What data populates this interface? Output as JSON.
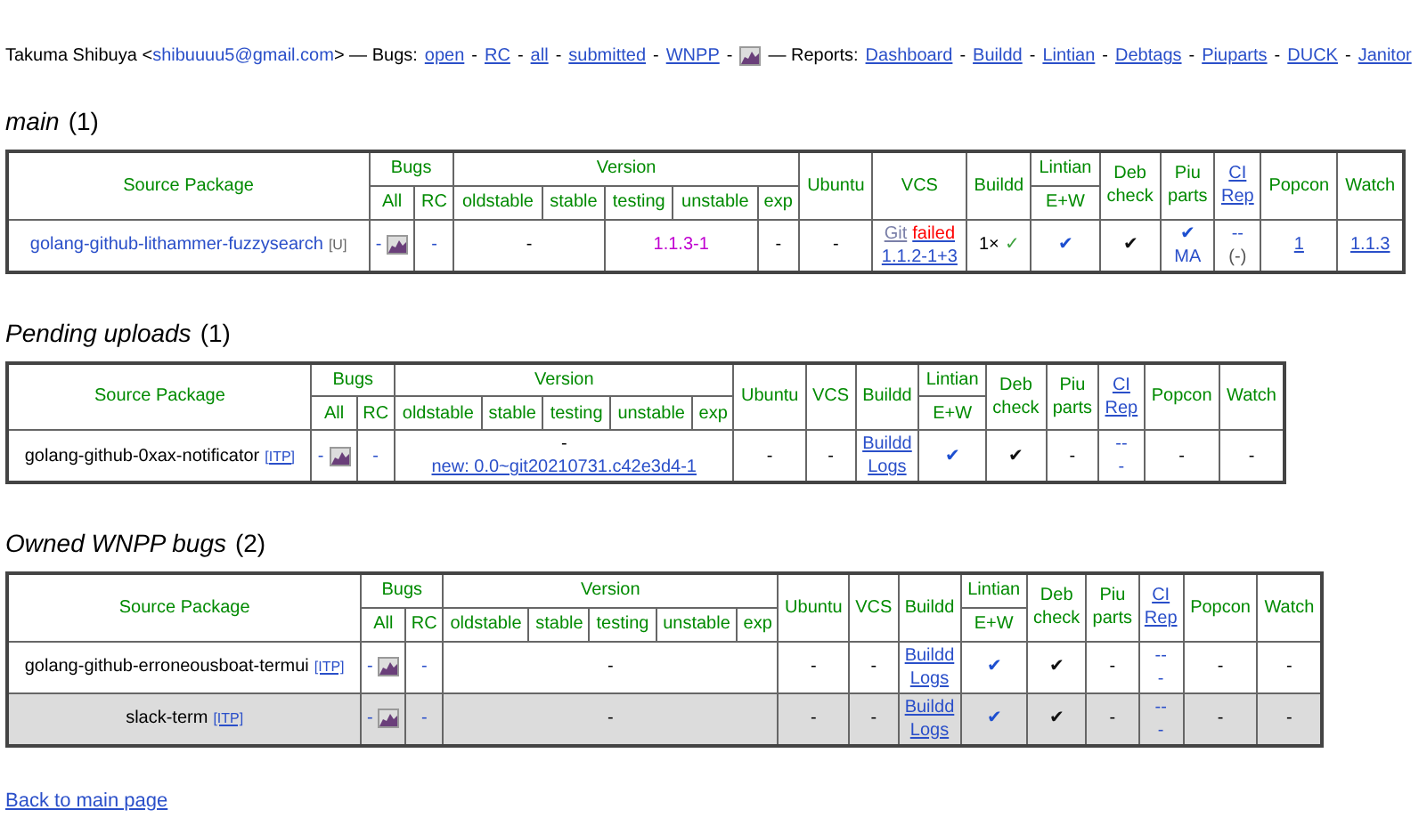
{
  "top_bar": [
    {
      "kind": "text",
      "text": "Takuma Shibuya <"
    },
    {
      "kind": "link-plain",
      "text": "shibuuuu5@gmail.com"
    },
    {
      "kind": "text",
      "text": "> — Bugs:"
    },
    {
      "kind": "link",
      "text": "open"
    },
    {
      "kind": "text",
      "text": "-"
    },
    {
      "kind": "link",
      "text": "RC"
    },
    {
      "kind": "text",
      "text": "-"
    },
    {
      "kind": "link",
      "text": "all"
    },
    {
      "kind": "text",
      "text": "-"
    },
    {
      "kind": "link",
      "text": "submitted"
    },
    {
      "kind": "text",
      "text": "-"
    },
    {
      "kind": "link",
      "text": "WNPP"
    },
    {
      "kind": "text",
      "text": "-"
    },
    {
      "kind": "icon"
    },
    {
      "kind": "text",
      "text": "— Reports:"
    },
    {
      "kind": "link",
      "text": "Dashboard"
    },
    {
      "kind": "text",
      "text": "-"
    },
    {
      "kind": "link",
      "text": "Buildd"
    },
    {
      "kind": "text",
      "text": "-"
    },
    {
      "kind": "link",
      "text": "Lintian"
    },
    {
      "kind": "text",
      "text": "-"
    },
    {
      "kind": "link",
      "text": "Debtags"
    },
    {
      "kind": "text",
      "text": "-"
    },
    {
      "kind": "link",
      "text": "Piuparts"
    },
    {
      "kind": "text",
      "text": "-"
    },
    {
      "kind": "link",
      "text": "DUCK"
    },
    {
      "kind": "text",
      "text": "-"
    },
    {
      "kind": "link",
      "text": "Janitor"
    }
  ],
  "sections": [
    {
      "title": "main",
      "count": "(1)",
      "header": [
        [
          {
            "rowspan": 2,
            "lines": [
              [
                {
                  "kind": "text",
                  "text": "Source Package"
                }
              ]
            ]
          },
          {
            "colspan": 2,
            "lines": [
              [
                {
                  "kind": "text",
                  "text": "Bugs"
                }
              ]
            ]
          },
          {
            "colspan": 5,
            "lines": [
              [
                {
                  "kind": "text",
                  "text": "Version"
                }
              ]
            ]
          },
          {
            "rowspan": 2,
            "lines": [
              [
                {
                  "kind": "text",
                  "text": "Ubuntu"
                }
              ]
            ]
          },
          {
            "rowspan": 2,
            "lines": [
              [
                {
                  "kind": "text",
                  "text": "VCS"
                }
              ]
            ]
          },
          {
            "rowspan": 2,
            "lines": [
              [
                {
                  "kind": "text",
                  "text": "Buildd"
                }
              ]
            ]
          },
          {
            "lines": [
              [
                {
                  "kind": "text",
                  "text": "Lintian"
                }
              ]
            ]
          },
          {
            "rowspan": 2,
            "lines": [
              [
                {
                  "kind": "text",
                  "text": "Deb"
                }
              ],
              [
                {
                  "kind": "text",
                  "text": "check"
                }
              ]
            ]
          },
          {
            "rowspan": 2,
            "lines": [
              [
                {
                  "kind": "text",
                  "text": "Piu"
                }
              ],
              [
                {
                  "kind": "text",
                  "text": "parts"
                }
              ]
            ]
          },
          {
            "rowspan": 2,
            "lines": [
              [
                {
                  "kind": "link",
                  "text": "CI"
                }
              ],
              [
                {
                  "kind": "link",
                  "text": "Rep"
                }
              ]
            ]
          },
          {
            "rowspan": 2,
            "lines": [
              [
                {
                  "kind": "text",
                  "text": "Popcon"
                }
              ]
            ]
          },
          {
            "rowspan": 2,
            "lines": [
              [
                {
                  "kind": "text",
                  "text": "Watch"
                }
              ]
            ]
          }
        ],
        [
          {
            "lines": [
              [
                {
                  "kind": "text",
                  "text": "All"
                }
              ]
            ]
          },
          {
            "lines": [
              [
                {
                  "kind": "text",
                  "text": "RC"
                }
              ]
            ]
          },
          {
            "lines": [
              [
                {
                  "kind": "text",
                  "text": "oldstable"
                }
              ]
            ]
          },
          {
            "lines": [
              [
                {
                  "kind": "text",
                  "text": "stable"
                }
              ]
            ]
          },
          {
            "lines": [
              [
                {
                  "kind": "text",
                  "text": "testing"
                }
              ]
            ]
          },
          {
            "lines": [
              [
                {
                  "kind": "text",
                  "text": "unstable"
                }
              ]
            ]
          },
          {
            "lines": [
              [
                {
                  "kind": "text",
                  "text": "exp"
                }
              ]
            ]
          },
          {
            "lines": [
              [
                {
                  "kind": "text",
                  "text": "E+W"
                }
              ]
            ]
          }
        ]
      ],
      "rows": [
        {
          "highlight": false,
          "cells": [
            {
              "lines": [
                [
                  {
                    "kind": "link-plain",
                    "text": "golang-github-lithammer-fuzzysearch"
                  },
                  {
                    "kind": "tag",
                    "text": "[U]"
                  }
                ]
              ]
            },
            {
              "lines": [
                [
                  {
                    "kind": "link-plain",
                    "text": "-"
                  },
                  {
                    "kind": "icon"
                  }
                ]
              ]
            },
            {
              "lines": [
                [
                  {
                    "kind": "link-plain",
                    "text": "-"
                  }
                ]
              ]
            },
            {
              "colspan": 2,
              "lines": [
                [
                  {
                    "kind": "text",
                    "text": "-"
                  }
                ]
              ]
            },
            {
              "colspan": 2,
              "lines": [
                [
                  {
                    "kind": "magenta",
                    "text": "1.1.3-1"
                  }
                ]
              ]
            },
            {
              "lines": [
                [
                  {
                    "kind": "text",
                    "text": "-"
                  }
                ]
              ]
            },
            {
              "lines": [
                [
                  {
                    "kind": "text",
                    "text": "-"
                  }
                ]
              ]
            },
            {
              "lines": [
                [
                  {
                    "kind": "git",
                    "text": "Git"
                  },
                  {
                    "kind": "red",
                    "text": "failed"
                  }
                ],
                [
                  {
                    "kind": "link",
                    "text": "1.1.2-1+3"
                  }
                ]
              ]
            },
            {
              "lines": [
                [
                  {
                    "kind": "text",
                    "text": "1×"
                  },
                  {
                    "kind": "check-green",
                    "text": "✓"
                  }
                ]
              ]
            },
            {
              "lines": [
                [
                  {
                    "kind": "check-blue",
                    "text": "✔"
                  }
                ]
              ]
            },
            {
              "lines": [
                [
                  {
                    "kind": "check-black",
                    "text": "✔"
                  }
                ]
              ]
            },
            {
              "lines": [
                [
                  {
                    "kind": "check-blue",
                    "text": "✔"
                  }
                ],
                [
                  {
                    "kind": "blue",
                    "text": "MA"
                  }
                ]
              ]
            },
            {
              "lines": [
                [
                  {
                    "kind": "link-plain",
                    "text": "--"
                  }
                ],
                [
                  {
                    "kind": "grey",
                    "text": "(-)"
                  }
                ]
              ]
            },
            {
              "lines": [
                [
                  {
                    "kind": "link",
                    "text": "1"
                  }
                ]
              ]
            },
            {
              "lines": [
                [
                  {
                    "kind": "link",
                    "text": "1.1.3"
                  }
                ]
              ]
            }
          ]
        }
      ]
    },
    {
      "title": "Pending uploads",
      "count": "(1)",
      "header": [
        [
          {
            "rowspan": 2,
            "lines": [
              [
                {
                  "kind": "text",
                  "text": "Source Package"
                }
              ]
            ]
          },
          {
            "colspan": 2,
            "lines": [
              [
                {
                  "kind": "text",
                  "text": "Bugs"
                }
              ]
            ]
          },
          {
            "colspan": 5,
            "lines": [
              [
                {
                  "kind": "text",
                  "text": "Version"
                }
              ]
            ]
          },
          {
            "rowspan": 2,
            "lines": [
              [
                {
                  "kind": "text",
                  "text": "Ubuntu"
                }
              ]
            ]
          },
          {
            "rowspan": 2,
            "lines": [
              [
                {
                  "kind": "text",
                  "text": "VCS"
                }
              ]
            ]
          },
          {
            "rowspan": 2,
            "lines": [
              [
                {
                  "kind": "text",
                  "text": "Buildd"
                }
              ]
            ]
          },
          {
            "lines": [
              [
                {
                  "kind": "text",
                  "text": "Lintian"
                }
              ]
            ]
          },
          {
            "rowspan": 2,
            "lines": [
              [
                {
                  "kind": "text",
                  "text": "Deb"
                }
              ],
              [
                {
                  "kind": "text",
                  "text": "check"
                }
              ]
            ]
          },
          {
            "rowspan": 2,
            "lines": [
              [
                {
                  "kind": "text",
                  "text": "Piu"
                }
              ],
              [
                {
                  "kind": "text",
                  "text": "parts"
                }
              ]
            ]
          },
          {
            "rowspan": 2,
            "lines": [
              [
                {
                  "kind": "link",
                  "text": "CI"
                }
              ],
              [
                {
                  "kind": "link",
                  "text": "Rep"
                }
              ]
            ]
          },
          {
            "rowspan": 2,
            "lines": [
              [
                {
                  "kind": "text",
                  "text": "Popcon"
                }
              ]
            ]
          },
          {
            "rowspan": 2,
            "lines": [
              [
                {
                  "kind": "text",
                  "text": "Watch"
                }
              ]
            ]
          }
        ],
        [
          {
            "lines": [
              [
                {
                  "kind": "text",
                  "text": "All"
                }
              ]
            ]
          },
          {
            "lines": [
              [
                {
                  "kind": "text",
                  "text": "RC"
                }
              ]
            ]
          },
          {
            "lines": [
              [
                {
                  "kind": "text",
                  "text": "oldstable"
                }
              ]
            ]
          },
          {
            "lines": [
              [
                {
                  "kind": "text",
                  "text": "stable"
                }
              ]
            ]
          },
          {
            "lines": [
              [
                {
                  "kind": "text",
                  "text": "testing"
                }
              ]
            ]
          },
          {
            "lines": [
              [
                {
                  "kind": "text",
                  "text": "unstable"
                }
              ]
            ]
          },
          {
            "lines": [
              [
                {
                  "kind": "text",
                  "text": "exp"
                }
              ]
            ]
          },
          {
            "lines": [
              [
                {
                  "kind": "text",
                  "text": "E+W"
                }
              ]
            ]
          }
        ]
      ],
      "rows": [
        {
          "highlight": false,
          "cells": [
            {
              "lines": [
                [
                  {
                    "kind": "text",
                    "text": "golang-github-0xax-notificator"
                  },
                  {
                    "kind": "tag-link",
                    "text": "[ITP]"
                  }
                ]
              ]
            },
            {
              "lines": [
                [
                  {
                    "kind": "link-plain",
                    "text": "-"
                  },
                  {
                    "kind": "icon"
                  }
                ]
              ]
            },
            {
              "lines": [
                [
                  {
                    "kind": "link-plain",
                    "text": "-"
                  }
                ]
              ]
            },
            {
              "colspan": 5,
              "lines": [
                [
                  {
                    "kind": "text",
                    "text": "-"
                  }
                ],
                [
                  {
                    "kind": "link",
                    "text": "new: 0.0~git20210731.c42e3d4-1"
                  }
                ]
              ]
            },
            {
              "lines": [
                [
                  {
                    "kind": "text",
                    "text": "-"
                  }
                ]
              ]
            },
            {
              "lines": [
                [
                  {
                    "kind": "text",
                    "text": "-"
                  }
                ]
              ]
            },
            {
              "lines": [
                [
                  {
                    "kind": "link",
                    "text": "Buildd"
                  }
                ],
                [
                  {
                    "kind": "link",
                    "text": "Logs"
                  }
                ]
              ]
            },
            {
              "lines": [
                [
                  {
                    "kind": "check-blue",
                    "text": "✔"
                  }
                ]
              ]
            },
            {
              "lines": [
                [
                  {
                    "kind": "check-black",
                    "text": "✔"
                  }
                ]
              ]
            },
            {
              "lines": [
                [
                  {
                    "kind": "text",
                    "text": "-"
                  }
                ]
              ]
            },
            {
              "lines": [
                [
                  {
                    "kind": "link-plain",
                    "text": "--"
                  }
                ],
                [
                  {
                    "kind": "link-plain",
                    "text": "-"
                  }
                ]
              ]
            },
            {
              "lines": [
                [
                  {
                    "kind": "text",
                    "text": "-"
                  }
                ]
              ]
            },
            {
              "lines": [
                [
                  {
                    "kind": "text",
                    "text": "-"
                  }
                ]
              ]
            }
          ]
        }
      ]
    },
    {
      "title": "Owned WNPP bugs",
      "count": "(2)",
      "header": [
        [
          {
            "rowspan": 2,
            "lines": [
              [
                {
                  "kind": "text",
                  "text": "Source Package"
                }
              ]
            ]
          },
          {
            "colspan": 2,
            "lines": [
              [
                {
                  "kind": "text",
                  "text": "Bugs"
                }
              ]
            ]
          },
          {
            "colspan": 5,
            "lines": [
              [
                {
                  "kind": "text",
                  "text": "Version"
                }
              ]
            ]
          },
          {
            "rowspan": 2,
            "lines": [
              [
                {
                  "kind": "text",
                  "text": "Ubuntu"
                }
              ]
            ]
          },
          {
            "rowspan": 2,
            "lines": [
              [
                {
                  "kind": "text",
                  "text": "VCS"
                }
              ]
            ]
          },
          {
            "rowspan": 2,
            "lines": [
              [
                {
                  "kind": "text",
                  "text": "Buildd"
                }
              ]
            ]
          },
          {
            "lines": [
              [
                {
                  "kind": "text",
                  "text": "Lintian"
                }
              ]
            ]
          },
          {
            "rowspan": 2,
            "lines": [
              [
                {
                  "kind": "text",
                  "text": "Deb"
                }
              ],
              [
                {
                  "kind": "text",
                  "text": "check"
                }
              ]
            ]
          },
          {
            "rowspan": 2,
            "lines": [
              [
                {
                  "kind": "text",
                  "text": "Piu"
                }
              ],
              [
                {
                  "kind": "text",
                  "text": "parts"
                }
              ]
            ]
          },
          {
            "rowspan": 2,
            "lines": [
              [
                {
                  "kind": "link",
                  "text": "CI"
                }
              ],
              [
                {
                  "kind": "link",
                  "text": "Rep"
                }
              ]
            ]
          },
          {
            "rowspan": 2,
            "lines": [
              [
                {
                  "kind": "text",
                  "text": "Popcon"
                }
              ]
            ]
          },
          {
            "rowspan": 2,
            "lines": [
              [
                {
                  "kind": "text",
                  "text": "Watch"
                }
              ]
            ]
          }
        ],
        [
          {
            "lines": [
              [
                {
                  "kind": "text",
                  "text": "All"
                }
              ]
            ]
          },
          {
            "lines": [
              [
                {
                  "kind": "text",
                  "text": "RC"
                }
              ]
            ]
          },
          {
            "lines": [
              [
                {
                  "kind": "text",
                  "text": "oldstable"
                }
              ]
            ]
          },
          {
            "lines": [
              [
                {
                  "kind": "text",
                  "text": "stable"
                }
              ]
            ]
          },
          {
            "lines": [
              [
                {
                  "kind": "text",
                  "text": "testing"
                }
              ]
            ]
          },
          {
            "lines": [
              [
                {
                  "kind": "text",
                  "text": "unstable"
                }
              ]
            ]
          },
          {
            "lines": [
              [
                {
                  "kind": "text",
                  "text": "exp"
                }
              ]
            ]
          },
          {
            "lines": [
              [
                {
                  "kind": "text",
                  "text": "E+W"
                }
              ]
            ]
          }
        ]
      ],
      "rows": [
        {
          "highlight": false,
          "cells": [
            {
              "lines": [
                [
                  {
                    "kind": "text",
                    "text": "golang-github-erroneousboat-termui"
                  },
                  {
                    "kind": "tag-link",
                    "text": "[ITP]"
                  }
                ]
              ]
            },
            {
              "lines": [
                [
                  {
                    "kind": "link-plain",
                    "text": "-"
                  },
                  {
                    "kind": "icon"
                  }
                ]
              ]
            },
            {
              "lines": [
                [
                  {
                    "kind": "link-plain",
                    "text": "-"
                  }
                ]
              ]
            },
            {
              "colspan": 5,
              "lines": [
                [
                  {
                    "kind": "text",
                    "text": "-"
                  }
                ]
              ]
            },
            {
              "lines": [
                [
                  {
                    "kind": "text",
                    "text": "-"
                  }
                ]
              ]
            },
            {
              "lines": [
                [
                  {
                    "kind": "text",
                    "text": "-"
                  }
                ]
              ]
            },
            {
              "lines": [
                [
                  {
                    "kind": "link",
                    "text": "Buildd"
                  }
                ],
                [
                  {
                    "kind": "link",
                    "text": "Logs"
                  }
                ]
              ]
            },
            {
              "lines": [
                [
                  {
                    "kind": "check-blue",
                    "text": "✔"
                  }
                ]
              ]
            },
            {
              "lines": [
                [
                  {
                    "kind": "check-black",
                    "text": "✔"
                  }
                ]
              ]
            },
            {
              "lines": [
                [
                  {
                    "kind": "text",
                    "text": "-"
                  }
                ]
              ]
            },
            {
              "lines": [
                [
                  {
                    "kind": "link-plain",
                    "text": "--"
                  }
                ],
                [
                  {
                    "kind": "link-plain",
                    "text": "-"
                  }
                ]
              ]
            },
            {
              "lines": [
                [
                  {
                    "kind": "text",
                    "text": "-"
                  }
                ]
              ]
            },
            {
              "lines": [
                [
                  {
                    "kind": "text",
                    "text": "-"
                  }
                ]
              ]
            }
          ]
        },
        {
          "highlight": true,
          "cells": [
            {
              "lines": [
                [
                  {
                    "kind": "text",
                    "text": "slack-term"
                  },
                  {
                    "kind": "tag-link",
                    "text": "[ITP]"
                  }
                ]
              ]
            },
            {
              "lines": [
                [
                  {
                    "kind": "link-plain",
                    "text": "-"
                  },
                  {
                    "kind": "icon"
                  }
                ]
              ]
            },
            {
              "lines": [
                [
                  {
                    "kind": "link-plain",
                    "text": "-"
                  }
                ]
              ]
            },
            {
              "colspan": 5,
              "lines": [
                [
                  {
                    "kind": "text",
                    "text": "-"
                  }
                ]
              ]
            },
            {
              "lines": [
                [
                  {
                    "kind": "text",
                    "text": "-"
                  }
                ]
              ]
            },
            {
              "lines": [
                [
                  {
                    "kind": "text",
                    "text": "-"
                  }
                ]
              ]
            },
            {
              "lines": [
                [
                  {
                    "kind": "link",
                    "text": "Buildd"
                  }
                ],
                [
                  {
                    "kind": "link",
                    "text": "Logs"
                  }
                ]
              ]
            },
            {
              "lines": [
                [
                  {
                    "kind": "check-blue",
                    "text": "✔"
                  }
                ]
              ]
            },
            {
              "lines": [
                [
                  {
                    "kind": "check-black",
                    "text": "✔"
                  }
                ]
              ]
            },
            {
              "lines": [
                [
                  {
                    "kind": "text",
                    "text": "-"
                  }
                ]
              ]
            },
            {
              "lines": [
                [
                  {
                    "kind": "link-plain",
                    "text": "--"
                  }
                ],
                [
                  {
                    "kind": "link-plain",
                    "text": "-"
                  }
                ]
              ]
            },
            {
              "lines": [
                [
                  {
                    "kind": "text",
                    "text": "-"
                  }
                ]
              ]
            },
            {
              "lines": [
                [
                  {
                    "kind": "text",
                    "text": "-"
                  }
                ]
              ]
            }
          ]
        }
      ]
    }
  ],
  "footer_link": "Back to main page"
}
